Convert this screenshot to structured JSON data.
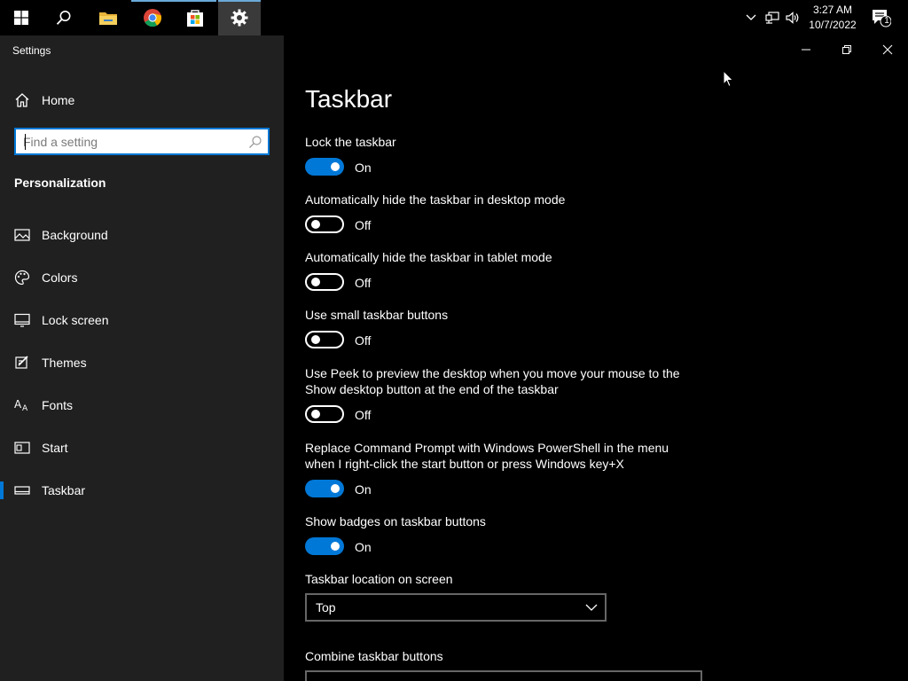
{
  "taskbar": {
    "clock_time": "3:27 AM",
    "clock_date": "10/7/2022",
    "notification_count": "1"
  },
  "app": {
    "title": "Settings"
  },
  "sidebar": {
    "home_label": "Home",
    "search_placeholder": "Find a setting",
    "section_title": "Personalization",
    "items": [
      {
        "label": "Background"
      },
      {
        "label": "Colors"
      },
      {
        "label": "Lock screen"
      },
      {
        "label": "Themes"
      },
      {
        "label": "Fonts"
      },
      {
        "label": "Start"
      },
      {
        "label": "Taskbar"
      }
    ],
    "selected_index": 6
  },
  "page": {
    "title": "Taskbar",
    "settings": [
      {
        "label": "Lock the taskbar",
        "state": "On"
      },
      {
        "label": "Automatically hide the taskbar in desktop mode",
        "state": "Off"
      },
      {
        "label": "Automatically hide the taskbar in tablet mode",
        "state": "Off"
      },
      {
        "label": "Use small taskbar buttons",
        "state": "Off"
      },
      {
        "label": "Use Peek to preview the desktop when you move your mouse to the Show desktop button at the end of the taskbar",
        "state": "Off"
      },
      {
        "label": "Replace Command Prompt with Windows PowerShell in the menu when I right-click the start button or press Windows key+X",
        "state": "On"
      },
      {
        "label": "Show badges on taskbar buttons",
        "state": "On"
      }
    ],
    "location_label": "Taskbar location on screen",
    "location_value": "Top",
    "combine_label": "Combine taskbar buttons"
  },
  "colors": {
    "accent": "#0078d7",
    "sidebar_bg": "#202020",
    "main_bg": "#000000"
  }
}
